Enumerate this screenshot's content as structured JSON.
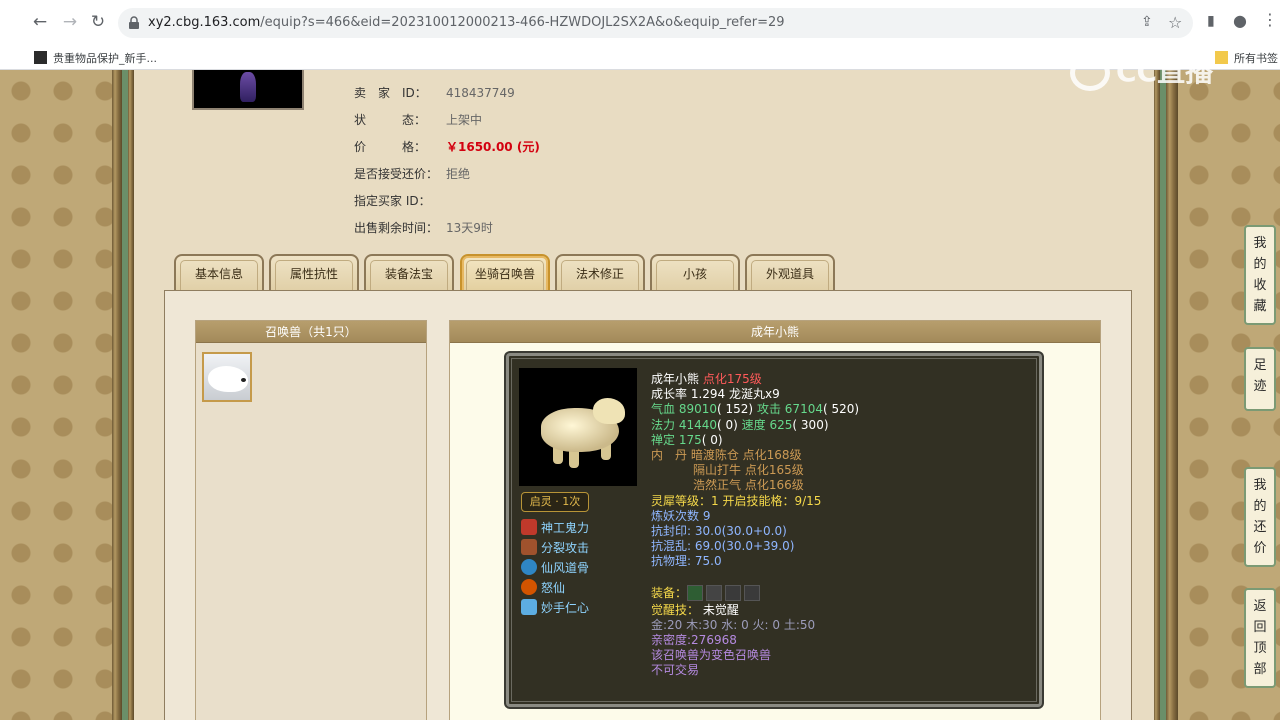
{
  "browser": {
    "back": "←",
    "forward": "→",
    "reload": "↻",
    "url_host": "xy2.cbg.163.com",
    "url_path": "/equip?s=466&eid=202310012000213-466-HZWDOJL2SX2A&o&equip_refer=29",
    "share": "⇪",
    "star": "☆",
    "sidepanel": "▮",
    "profile": "●",
    "menu": "⋮"
  },
  "bookmarks": {
    "left": "贵重物品保护_新手...",
    "right": "所有书签"
  },
  "watermark": "CC直播",
  "seller": {
    "rows": [
      {
        "label": "卖　家　ID：",
        "value": "418437749"
      },
      {
        "label": "状　　　态：",
        "value": "上架中"
      },
      {
        "label": "价　　　格：",
        "value": "￥1650.00 (元)"
      },
      {
        "label": "是否接受还价：",
        "value": "拒绝"
      },
      {
        "label": "指定买家 ID：",
        "value": ""
      },
      {
        "label": "出售剩余时间：",
        "value": "13天9时"
      }
    ]
  },
  "tabs": [
    "基本信息",
    "属性抗性",
    "装备法宝",
    "坐骑召唤兽",
    "法术修正",
    "小孩",
    "外观道具"
  ],
  "pet_list": {
    "title": "召唤兽（共1只）"
  },
  "pet_detail": {
    "title": "成年小熊",
    "qiling": "启灵 · 1次",
    "skills": [
      "神工鬼力",
      "分裂攻击",
      "仙风道骨",
      "怒仙",
      "妙手仁心"
    ],
    "name": "成年小熊",
    "level": "点化175级",
    "growth": "成长率 1.294 龙涎丸x9",
    "hp_label": "气血",
    "hp": "89010",
    "hp_extra": "( 152)",
    "atk_label": "攻击",
    "atk": "67104",
    "atk_extra": "( 520)",
    "mp_label": "法力",
    "mp": "41440",
    "mp_extra": "( 0)",
    "spd_label": "速度",
    "spd": "625",
    "spd_extra": "( 300)",
    "ding_label": "禅定",
    "ding": "175",
    "ding_extra": "( 0)",
    "neidan_label": "内　丹",
    "neidan": [
      "暗渡陈仓 点化168级",
      "隔山打牛 点化165级",
      "浩然正气 点化166级"
    ],
    "lingxi": "灵犀等级：",
    "lingxi_val": "1 开启技能格：",
    "lingxi_slots": "9/15",
    "lianyao": "炼妖次数 9",
    "kangfeng": "抗封印: 30.0(30.0+0.0)",
    "kanghun": "抗混乱: 69.0(30.0+39.0)",
    "kangwu": "抗物理: 75.0",
    "equip_label": "装备：",
    "awake_label": "觉醒技：",
    "awake_val": "未觉醒",
    "elements": "金:20 木:30 水: 0 火: 0 土:50",
    "intimacy": "亲密度:276968",
    "note1": "该召唤兽为变色召唤兽",
    "note2": "不可交易"
  },
  "float_buttons": [
    {
      "chars": [
        "我",
        "的",
        "收",
        "藏"
      ]
    },
    {
      "chars": [
        "足",
        "迹"
      ]
    },
    {
      "chars": [
        "我",
        "的",
        "还",
        "价"
      ]
    },
    {
      "chars": [
        "返",
        "回",
        "顶",
        "部"
      ]
    }
  ]
}
